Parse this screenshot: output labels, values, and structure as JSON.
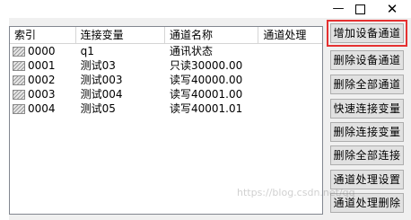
{
  "title_bar": {
    "minimize_symbol": "—",
    "close_symbol": "✕"
  },
  "list": {
    "columns": [
      "索引",
      "连接变量",
      "通道名称",
      "通道处理"
    ],
    "rows": [
      {
        "index": "0000",
        "variable": "q1",
        "channel": "通讯状态",
        "process": ""
      },
      {
        "index": "0001",
        "variable": "测试03",
        "channel": "只读30000.00",
        "process": ""
      },
      {
        "index": "0002",
        "variable": "测试003",
        "channel": "读写40000.00",
        "process": ""
      },
      {
        "index": "0003",
        "variable": "测试004",
        "channel": "读写40001.00",
        "process": ""
      },
      {
        "index": "0004",
        "variable": "测试05",
        "channel": "读写40001.01",
        "process": ""
      }
    ]
  },
  "buttons": [
    "增加设备通道",
    "删除设备通道",
    "删除全部通道",
    "快速连接变量",
    "删除连接变量",
    "删除全部连接",
    "通道处理设置",
    "通道处理删除"
  ],
  "watermark": "https://blog.csdn.net/qq",
  "colors": {
    "highlight_border": "#e53030",
    "button_face": "#e1e1e1"
  }
}
